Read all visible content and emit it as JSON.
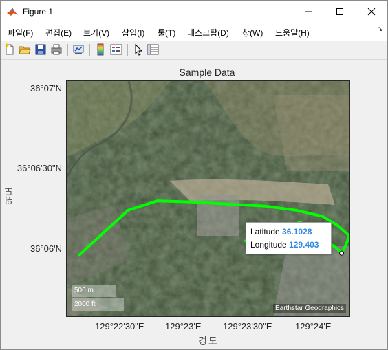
{
  "window": {
    "title": "Figure 1",
    "controls": {
      "minimize": "minimize",
      "maximize": "maximize",
      "close": "close"
    }
  },
  "menu": {
    "items": [
      "파일(F)",
      "편집(E)",
      "보기(V)",
      "삽입(I)",
      "툴(T)",
      "데스크탑(D)",
      "창(W)",
      "도움말(H)"
    ]
  },
  "toolbar": {
    "buttons": [
      {
        "icon": "new-figure-icon"
      },
      {
        "icon": "open-file-icon"
      },
      {
        "icon": "save-icon"
      },
      {
        "icon": "print-icon"
      },
      {
        "icon": "link-plot-icon"
      },
      {
        "icon": "colorbar-icon"
      },
      {
        "icon": "legend-icon"
      },
      {
        "icon": "pointer-icon"
      },
      {
        "icon": "property-inspector-icon"
      }
    ]
  },
  "chart_data": {
    "type": "line",
    "title": "Sample Data",
    "xlabel": "경도",
    "ylabel": "위도",
    "x_ticks": [
      "129°22'30\"E",
      "129°23'E",
      "129°23'30\"E",
      "129°24'E"
    ],
    "y_ticks": [
      "36°07'N",
      "36°06'30\"N",
      "36°06'N"
    ],
    "series": [
      {
        "color": "#00ff00",
        "lon": [
          129.3688,
          129.372,
          129.3752,
          129.379,
          129.3835,
          129.388,
          129.393,
          129.397,
          129.4005,
          129.4025,
          129.404,
          129.4035,
          129.403
        ],
        "lat": [
          36.1026,
          36.1048,
          36.107,
          36.1079,
          36.1078,
          36.1076,
          36.1074,
          36.107,
          36.1064,
          36.1055,
          36.1045,
          36.1035,
          36.1028
        ]
      },
      {
        "color": "#00ff00",
        "lon": [
          129.3905,
          129.393,
          129.3955,
          129.3975,
          129.3985,
          129.3995,
          129.401,
          129.4025,
          129.403
        ],
        "lat": [
          36.104,
          36.1045,
          36.1052,
          36.1058,
          36.1056,
          36.1048,
          36.104,
          36.1032,
          36.1028
        ]
      }
    ],
    "lon_range": [
      129.3672,
      129.4042
    ],
    "lat_range": [
      36.0965,
      36.1196
    ],
    "basemap": "satellite",
    "grid": false
  },
  "datatip": {
    "lat_label": "Latitude",
    "lat_value": "36.1028",
    "lon_label": "Longitude",
    "lon_value": "129.403"
  },
  "scalebar": {
    "metric": "500 m",
    "imperial": "2000 ft"
  },
  "attribution": "Earthstar Geographics"
}
